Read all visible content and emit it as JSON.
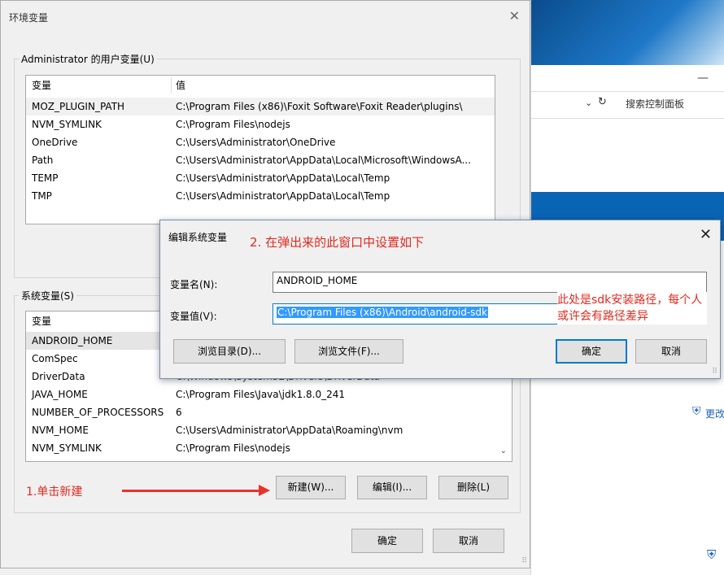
{
  "background_window": {
    "minimize_glyph": "—",
    "dropdown_glyph": "⌄",
    "refresh_glyph": "↻",
    "search_placeholder": "搜索控制面板",
    "more_link": "更改",
    "shield_icon": "shield-icon"
  },
  "env_dialog": {
    "title": "环境变量",
    "close_glyph": "✕",
    "user_group_label": "Administrator 的用户变量(U)",
    "user_table": {
      "headers": [
        "变量",
        "值"
      ],
      "rows": [
        {
          "name": "MOZ_PLUGIN_PATH",
          "value": "C:\\Program Files (x86)\\Foxit Software\\Foxit Reader\\plugins\\"
        },
        {
          "name": "NVM_SYMLINK",
          "value": "C:\\Program Files\\nodejs"
        },
        {
          "name": "OneDrive",
          "value": "C:\\Users\\Administrator\\OneDrive"
        },
        {
          "name": "Path",
          "value": "C:\\Users\\Administrator\\AppData\\Local\\Microsoft\\WindowsA..."
        },
        {
          "name": "TEMP",
          "value": "C:\\Users\\Administrator\\AppData\\Local\\Temp"
        },
        {
          "name": "TMP",
          "value": "C:\\Users\\Administrator\\AppData\\Local\\Temp"
        }
      ]
    },
    "system_group_label": "系统变量(S)",
    "system_table": {
      "headers": [
        "变量",
        "值"
      ],
      "rows": [
        {
          "name": "ANDROID_HOME",
          "value": ""
        },
        {
          "name": "ComSpec",
          "value": ""
        },
        {
          "name": "DriverData",
          "value": "C:\\Windows\\System32\\Drivers\\DriverData"
        },
        {
          "name": "JAVA_HOME",
          "value": "C:\\Program Files\\Java\\jdk1.8.0_241"
        },
        {
          "name": "NUMBER_OF_PROCESSORS",
          "value": "6"
        },
        {
          "name": "NVM_HOME",
          "value": "C:\\Users\\Administrator\\AppData\\Roaming\\nvm"
        },
        {
          "name": "NVM_SYMLINK",
          "value": "C:\\Program Files\\nodejs"
        }
      ]
    },
    "scroll_down_glyph": "⌄",
    "new_button": "新建(W)...",
    "edit_button": "编辑(I)...",
    "delete_button": "删除(L)",
    "ok_button": "确定",
    "cancel_button": "取消",
    "grip_glyph": "⠿"
  },
  "annotations": {
    "step1": "1.单击新建",
    "step2": "2. 在弹出来的此窗口中设置如下",
    "note": "此处是sdk安装路径，每个人或许会有路径差异",
    "color": "#e02a1f"
  },
  "edit_dialog": {
    "title": "编辑系统变量",
    "close_glyph": "✕",
    "name_label": "变量名(N):",
    "name_value": "ANDROID_HOME",
    "value_label": "变量值(V):",
    "value_value": "C:\\Program Files (x86)\\Android\\android-sdk",
    "browse_dir_button": "浏览目录(D)...",
    "browse_file_button": "浏览文件(F)...",
    "ok_button": "确定",
    "cancel_button": "取消"
  }
}
